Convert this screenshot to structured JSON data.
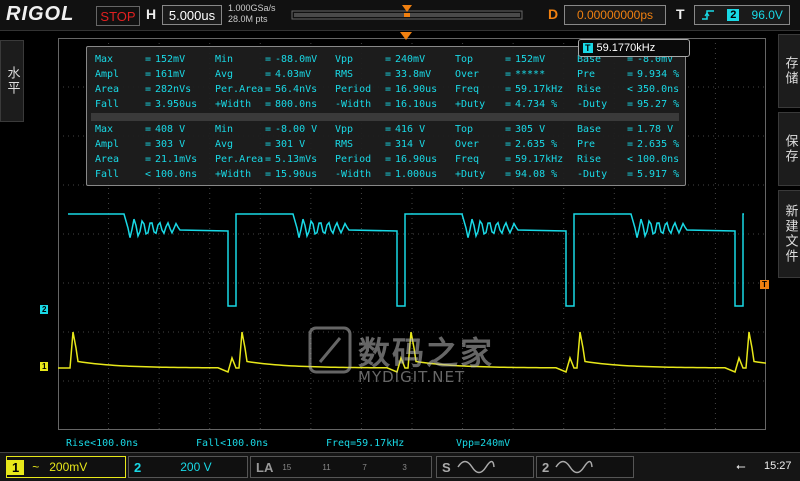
{
  "top": {
    "brand": "RIGOL",
    "run_state": "STOP",
    "h_label": "H",
    "timebase": "5.000us",
    "sample_rate": "1.000GSa/s",
    "mem_depth": "28.0M pts",
    "d_label": "D",
    "delay": "0.00000000ps",
    "t_label": "T",
    "trig_channel": "2",
    "trig_level": "96.0V",
    "trig_edge_icon": "rising-edge-icon"
  },
  "left_menu": {
    "label": "水平"
  },
  "right_menu": [
    {
      "label": "存储"
    },
    {
      "label": "保存"
    },
    {
      "label": "新建文件"
    }
  ],
  "freq_badge": {
    "ch": "T",
    "value": "59.1770kHz"
  },
  "measure": {
    "ch1_rows": [
      [
        [
          "Max",
          "=",
          "152mV"
        ],
        [
          "Min",
          "=",
          "-88.0mV"
        ],
        [
          "Vpp",
          "=",
          "240mV"
        ],
        [
          "Top",
          "=",
          "152mV"
        ],
        [
          "Base",
          "=",
          "-8.0mV"
        ]
      ],
      [
        [
          "Ampl",
          "=",
          "161mV"
        ],
        [
          "Avg",
          "=",
          "4.03mV"
        ],
        [
          "RMS",
          "=",
          "33.8mV"
        ],
        [
          "Over",
          "=",
          "*****"
        ],
        [
          "Pre",
          "=",
          "9.934 %"
        ]
      ],
      [
        [
          "Area",
          "=",
          "282nVs"
        ],
        [
          "Per.Area",
          "=",
          "56.4nVs"
        ],
        [
          "Period",
          "=",
          "16.90us"
        ],
        [
          "Freq",
          "=",
          "59.17kHz"
        ],
        [
          "Rise",
          "<",
          "350.0ns"
        ]
      ],
      [
        [
          "Fall",
          "=",
          "3.950us"
        ],
        [
          "+Width",
          "=",
          "800.0ns"
        ],
        [
          "-Width",
          "=",
          "16.10us"
        ],
        [
          "+Duty",
          "=",
          "4.734 %"
        ],
        [
          "-Duty",
          "=",
          "95.27 %"
        ]
      ]
    ],
    "ch2_rows": [
      [
        [
          "Max",
          "=",
          "408 V"
        ],
        [
          "Min",
          "=",
          "-8.00 V"
        ],
        [
          "Vpp",
          "=",
          "416 V"
        ],
        [
          "Top",
          "=",
          "305 V"
        ],
        [
          "Base",
          "=",
          "1.78 V"
        ]
      ],
      [
        [
          "Ampl",
          "=",
          "303 V"
        ],
        [
          "Avg",
          "=",
          "301 V"
        ],
        [
          "RMS",
          "=",
          "314 V"
        ],
        [
          "Over",
          "=",
          "2.635 %"
        ],
        [
          "Pre",
          "=",
          "2.635 %"
        ]
      ],
      [
        [
          "Area",
          "=",
          "21.1mVs"
        ],
        [
          "Per.Area",
          "=",
          "5.13mVs"
        ],
        [
          "Period",
          "=",
          "16.90us"
        ],
        [
          "Freq",
          "=",
          "59.17kHz"
        ],
        [
          "Rise",
          "<",
          "100.0ns"
        ]
      ],
      [
        [
          "Fall",
          "<",
          "100.0ns"
        ],
        [
          "+Width",
          "=",
          "15.90us"
        ],
        [
          "-Width",
          "=",
          "1.000us"
        ],
        [
          "+Duty",
          "=",
          "94.08 %"
        ],
        [
          "-Duty",
          "=",
          "5.917 %"
        ]
      ]
    ]
  },
  "bottom_readouts": {
    "rise": "Rise<100.0ns",
    "fall": "Fall<100.0ns",
    "freq": "Freq=59.17kHz",
    "vpp": "Vpp=240mV"
  },
  "channels": {
    "ch1": {
      "num": "1",
      "coupling": "~",
      "scale": "200mV",
      "color": "#e8e81a"
    },
    "ch2": {
      "num": "2",
      "coupling": "",
      "scale": "200 V",
      "color": "#19d9e6"
    }
  },
  "la": {
    "label": "LA",
    "ticks": [
      "15",
      "11",
      "7",
      "3"
    ]
  },
  "source_s": {
    "label": "S",
    "icon": "sine-wave-icon"
  },
  "source_2": {
    "label": "2",
    "icon": "sine-wave-icon"
  },
  "trigger_marker": {
    "label": "T",
    "color": "#f08010"
  },
  "ch1_marker": "1",
  "ch2_marker": "2",
  "watermark": {
    "cn": "数码之家",
    "en": "MYDIGIT.NET"
  },
  "status": {
    "clock": "15:27",
    "usb_icon": "usb-icon"
  },
  "colors": {
    "ch1": "#e8e81a",
    "ch2": "#19d9e6",
    "accent": "#f08010",
    "stop": "#e02020"
  }
}
